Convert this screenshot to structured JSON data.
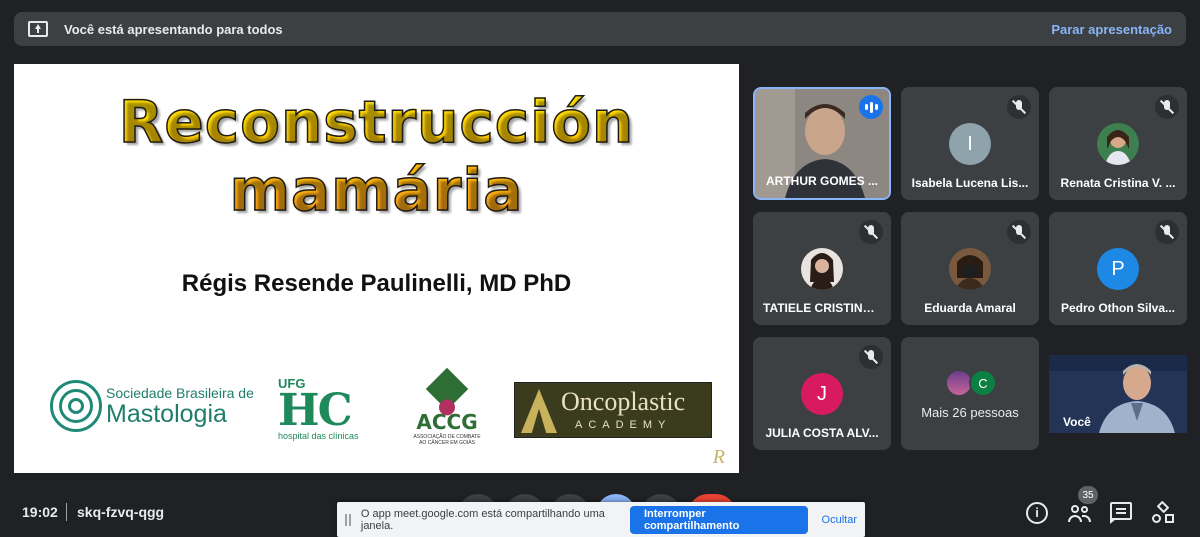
{
  "banner": {
    "presenting_text": "Você está apresentando para todos",
    "stop_label": "Parar apresentação"
  },
  "slide": {
    "title_line1": "Reconstrucción",
    "title_line2": "mamária",
    "author": "Régis Resende Paulinelli, MD PhD",
    "logos": {
      "sbm_small": "Sociedade Brasileira de",
      "sbm_big": "Mastologia",
      "ufg": "UFG",
      "hc": "HC",
      "hc_sub": "hospital das clínicas",
      "accg": "ACCG",
      "accg_sub": "ASSOCIAÇÃO DE COMBATE AO CÂNCER EM GOIÁS",
      "onco_name": "Oncoplastic",
      "onco_sub": "ACADEMY"
    }
  },
  "participants": [
    {
      "name": "ARTHUR GOMES ...",
      "speaking": true
    },
    {
      "name": "Isabela Lucena Lis...",
      "initial": "I",
      "color": "#8fa3ad"
    },
    {
      "name": "Renata Cristina V. ..."
    },
    {
      "name": "TATIELE CRISTINA..."
    },
    {
      "name": "Eduarda Amaral"
    },
    {
      "name": "Pedro Othon Silva...",
      "initial": "P",
      "color": "#1e88e5"
    },
    {
      "name": "JULIA COSTA ALV...",
      "initial": "J",
      "color": "#d81b60"
    }
  ],
  "more": {
    "label": "Mais 26 pessoas",
    "initial": "C"
  },
  "self": {
    "label": "Você"
  },
  "bottom": {
    "time": "19:02",
    "meeting_code": "skq-fzvq-qgg",
    "people_count": "35"
  },
  "share_bar": {
    "message": "O app meet.google.com está compartilhando uma janela.",
    "stop_label": "Interromper compartilhamento",
    "hide_label": "Ocultar"
  }
}
